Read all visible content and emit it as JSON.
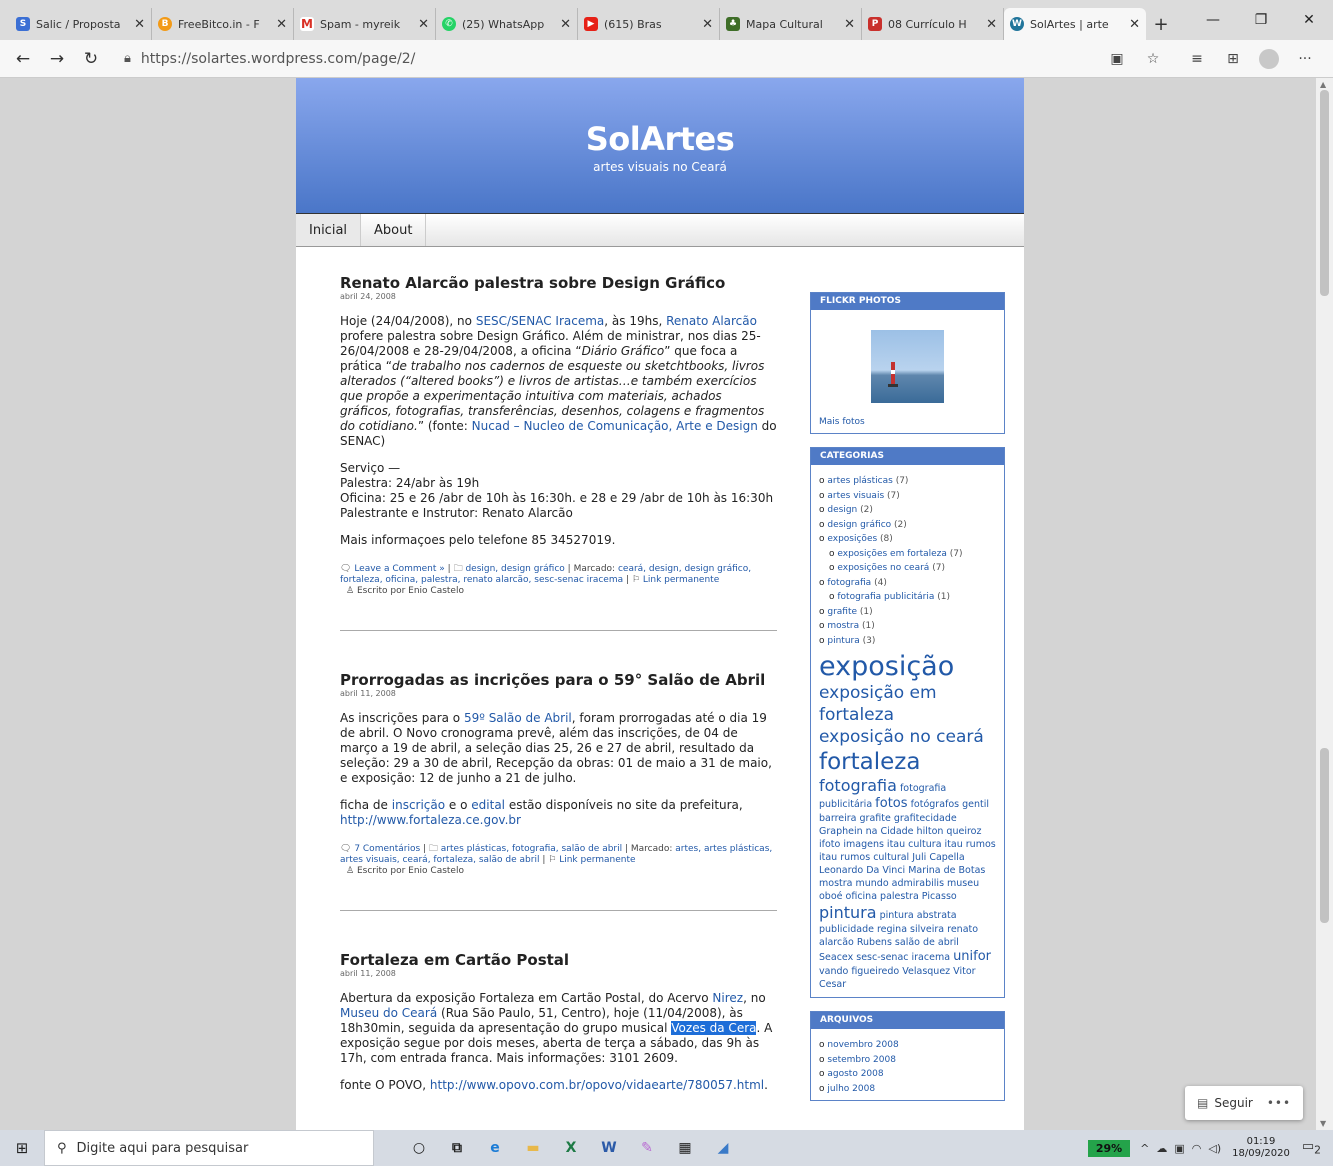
{
  "browser": {
    "tabs": [
      {
        "label": "Salic / Proposta",
        "icon": "salic-icon",
        "color": "#3b6fd4"
      },
      {
        "label": "FreeBitco.in - F",
        "icon": "bitcoin-icon",
        "color": "#f29a17"
      },
      {
        "label": "Spam - myreik",
        "icon": "gmail-icon",
        "color": "#d93025"
      },
      {
        "label": "(25) WhatsApp",
        "icon": "whatsapp-icon",
        "color": "#25d366"
      },
      {
        "label": "(615) Bras",
        "icon": "youtube-icon",
        "color": "#e62117"
      },
      {
        "label": "Mapa Cultural",
        "icon": "mapa-icon",
        "color": "#3f6e28"
      },
      {
        "label": "08 Currículo H",
        "icon": "pdf-icon",
        "color": "#c9302c"
      },
      {
        "label": "SolArtes | arte",
        "icon": "wordpress-icon",
        "color": "#21759b"
      }
    ],
    "url": "https://solartes.wordpress.com/page/2/"
  },
  "site": {
    "title": "SolArtes",
    "tagline": "artes visuais no Ceará",
    "menu": [
      "Inicial",
      "About"
    ]
  },
  "posts": [
    {
      "title": "Renato Alarcão palestra sobre Design Gráfico",
      "date": "abril 24, 2008",
      "p1": {
        "a": "Hoje (24/04/2008), no ",
        "link1": "SESC/SENAC Iracema",
        "b": ", às 19hs, ",
        "link2": "Renato Alarcão",
        "c": " profere palestra sobre Design Gráfico. Além de ministrar, nos dias 25-26/04/2008 e 28-29/04/2008, a oficina “",
        "em1": "Diário Gráfico",
        "d": "” que foca a prática “",
        "em2": "de trabalho nos cadernos de esqueste ou sketchtbooks, livros alterados (“altered books”) e livros de artistas…e também exercícios que propõe a experimentação intuitiva com materiais, achados gráficos, fotografias, transferências, desenhos, colagens e fragmentos do cotidiano.",
        "e": "” (fonte: ",
        "link3": "Nucad – Nucleo de Comunicação, Arte e Design",
        "f": " do SENAC)"
      },
      "servico": [
        "Serviço —",
        "Palestra: 24/abr às 19h",
        "Oficina: 25 e 26 /abr de 10h às 16:30h. e 28 e 29 /abr de 10h às 16:30h",
        "Palestrante e Instrutor: Renato Alarcão"
      ],
      "p3": "Mais informaçoes pelo telefone 85 34527019.",
      "comments": "Leave a Comment »",
      "cats": "design, design gráfico",
      "marcado": "Marcado:",
      "tags": "ceará, design, design gráfico, fortaleza, oficina, palestra, renato alarcão, sesc-senac iracema",
      "permalink": "Link permanente",
      "author": "Escrito por Enio Castelo"
    },
    {
      "title": "Prorrogadas as incrições para o 59° Salão de Abril",
      "date": "abril 11, 2008",
      "p1": {
        "a": "As inscrições para o ",
        "link1": "59º Salão de Abril",
        "b": ", foram prorrogadas até o dia 19 de abril. O Novo cronograma prevê, além das inscrições, de 04 de março a 19 de abril, a seleção dias 25, 26 e 27 de abril, resultado da seleção: 29 a 30 de abril, Recepção da obras: 01 de maio a 31 de maio, e exposição: 12 de junho a 21 de julho."
      },
      "p2": {
        "a": "ficha de ",
        "link1": "inscrição",
        "b": " e o ",
        "link2": "edital",
        "c": " estão disponíveis no site da prefeitura, ",
        "link3": "http://www.fortaleza.ce.gov.br"
      },
      "comments": "7 Comentários",
      "cats": "artes plásticas, fotografia, salão de abril",
      "marcado": "Marcado:",
      "tags": "artes, artes plásticas, artes visuais, ceará, fortaleza, salão de abril",
      "permalink": "Link permanente",
      "author": "Escrito por Enio Castelo"
    },
    {
      "title": "Fortaleza em Cartão Postal",
      "date": "abril 11, 2008",
      "p1": {
        "a": "Abertura da exposição Fortaleza em Cartão Postal, do Acervo ",
        "link1": "Nirez",
        "b": ", no ",
        "link2": "Museu do Ceará",
        "c": " (Rua São Paulo, 51, Centro), hoje (11/04/2008), às 18h30min, seguida da apresentação do grupo musical ",
        "sel": "Vozes da Cera",
        "d": ". A exposição segue por dois meses, aberta de terça a sábado, das 9h às 17h, com entrada franca. Mais informações: 3101 2609."
      },
      "p2": {
        "a": "fonte O POVO,  ",
        "link1": "http://www.opovo.com.br/opovo/vidaearte/780057.html",
        "b": "."
      }
    }
  ],
  "sidebar": {
    "flickr_title": "FLICKR PHOTOS",
    "flickr_more": "Mais fotos",
    "categories_title": "CATEGORIAS",
    "categories": [
      {
        "label": "artes plásticas",
        "count": "(7)",
        "sub": false
      },
      {
        "label": "artes visuais",
        "count": "(7)",
        "sub": false
      },
      {
        "label": "design",
        "count": "(2)",
        "sub": false
      },
      {
        "label": "design gráfico",
        "count": "(2)",
        "sub": false
      },
      {
        "label": "exposições",
        "count": "(8)",
        "sub": false
      },
      {
        "label": "exposições em fortaleza",
        "count": "(7)",
        "sub": true
      },
      {
        "label": "exposições no ceará",
        "count": "(7)",
        "sub": true
      },
      {
        "label": "fotografia",
        "count": "(4)",
        "sub": false
      },
      {
        "label": "fotografia publicitária",
        "count": "(1)",
        "sub": true
      },
      {
        "label": "grafite",
        "count": "(1)",
        "sub": false
      },
      {
        "label": "mostra",
        "count": "(1)",
        "sub": false
      },
      {
        "label": "pintura",
        "count": "(3)",
        "sub": false
      }
    ],
    "tags": {
      "t1": "exposição",
      "t2": "exposição em fortaleza",
      "t3": "exposição no ceará",
      "t4": "fortaleza",
      "t5": "fotografia",
      "t6": "fotografia publicitária",
      "t7": "fotos",
      "t8": "fotógrafos gentil barreira grafite grafitecidade Graphein na Cidade hilton queiroz ifoto imagens itau cultura itau rumos itau rumos cultural Juli Capella Leonardo Da Vinci Marina de Botas mostra mundo admirabilis museu oboé oficina palestra Picasso",
      "t9": "pintura",
      "t10": "pintura abstrata publicidade regina silveira renato alarcão Rubens salão de abril Seacex sesc-senac iracema",
      "t11": "unifor",
      "t12": "vando figueiredo Velasquez Vitor Cesar"
    },
    "archives_title": "ARQUIVOS",
    "archives": [
      "novembro 2008",
      "setembro 2008",
      "agosto 2008",
      "julho 2008"
    ]
  },
  "follow": {
    "label": "Seguir",
    "dots": "•••"
  },
  "taskbar": {
    "search_placeholder": "Digite aqui para pesquisar",
    "battery": "29%",
    "time": "01:19",
    "date": "18/09/2020",
    "notifications": "2"
  }
}
